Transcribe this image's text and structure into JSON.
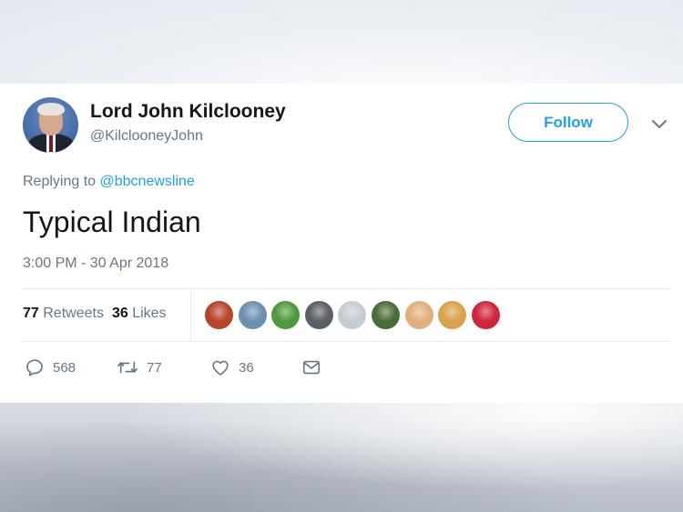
{
  "user": {
    "display_name": "Lord John Kilclooney",
    "handle": "@KilclooneyJohn"
  },
  "follow_button": {
    "label": "Follow"
  },
  "reply": {
    "prefix": "Replying to",
    "mention": "@bbcnewsline"
  },
  "tweet": {
    "text": "Typical Indian",
    "timestamp": "3:00 PM - 30 Apr 2018"
  },
  "stats": {
    "retweets_count": "77",
    "retweets_label": "Retweets",
    "likes_count": "36",
    "likes_label": "Likes"
  },
  "likers": [
    {
      "icon": "silhouette-sunset-avatar",
      "color": "#b8442a"
    },
    {
      "icon": "cartoon-avatar",
      "color": "#6b8fb0"
    },
    {
      "icon": "green-figure-avatar",
      "color": "#4f9a3c"
    },
    {
      "icon": "animal-avatar",
      "color": "#5a5f66"
    },
    {
      "icon": "default-avatar",
      "color": "#c5ccd3"
    },
    {
      "icon": "dark-green-avatar",
      "color": "#4b6b3a"
    },
    {
      "icon": "person-avatar",
      "color": "#e0b07a"
    },
    {
      "icon": "food-avatar",
      "color": "#d9a14a"
    },
    {
      "icon": "red-rose-avatar",
      "color": "#d0243a"
    }
  ],
  "actions": {
    "reply_count": "568",
    "retweet_count": "77",
    "like_count": "36"
  },
  "colors": {
    "accent": "#1da1f2",
    "text_primary": "#14171a",
    "text_secondary": "#657786"
  }
}
